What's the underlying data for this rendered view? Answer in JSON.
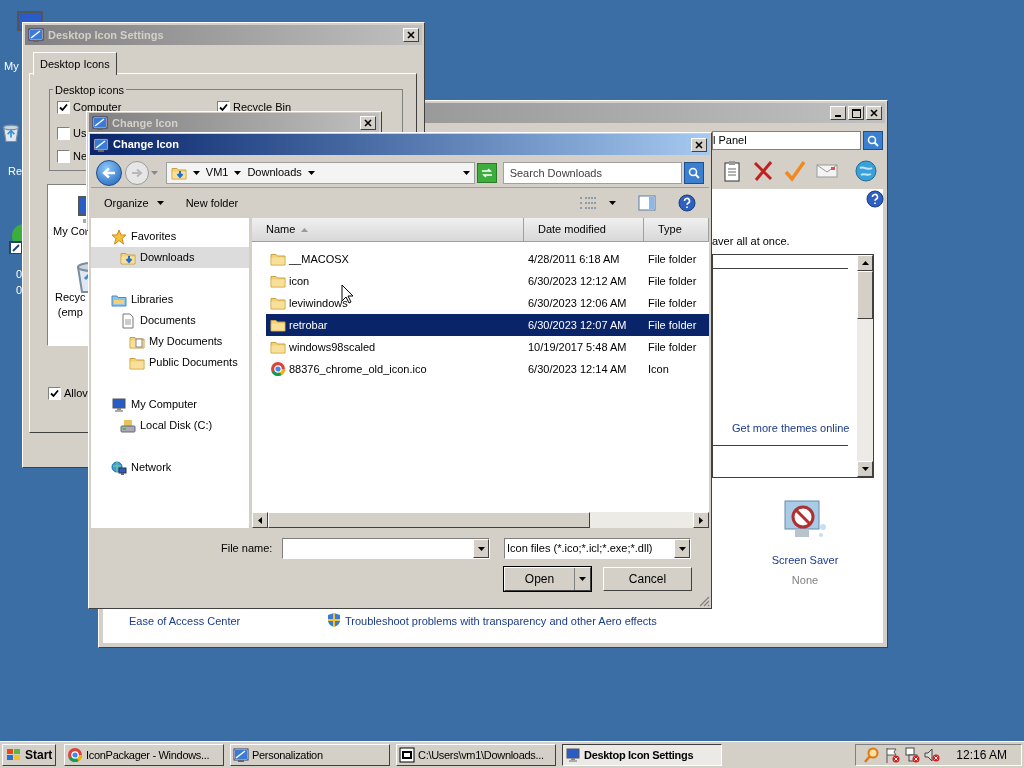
{
  "desktop_icons": [
    {
      "kind": "computer",
      "label_lines": [
        "My"
      ]
    },
    {
      "kind": "recycle",
      "label_lines": [
        "Re"
      ]
    },
    {
      "kind": "app",
      "label_lines": [
        "0",
        "0"
      ]
    }
  ],
  "personalization_window": {
    "active": false,
    "address": "l Panel",
    "intro_fragment": "aver all at once.",
    "themes_link": "Get more themes online",
    "screen_saver": {
      "label": "Screen Saver",
      "value": "None"
    },
    "see_also_link": "Ease of Access Center",
    "troubleshoot_link": "Troubleshoot problems with transparency and other Aero effects"
  },
  "desktop_icon_settings": {
    "title": "Desktop Icon Settings",
    "active": false,
    "tabs": [
      {
        "label": "Desktop Icons",
        "selected": true
      }
    ],
    "group_title": "Desktop icons",
    "checkboxes": [
      {
        "label": "Computer",
        "checked": true
      },
      {
        "label": "Recycle Bin",
        "checked": true
      },
      {
        "label": "Us",
        "checked": false
      },
      {
        "label": "Ne",
        "checked": false
      }
    ],
    "icon_list": [
      {
        "kind": "computer",
        "label_lines": [
          "My Cor"
        ]
      },
      {
        "kind": "recycle",
        "label_lines": [
          "Recyc",
          "(emp"
        ]
      }
    ],
    "allow_checkbox": {
      "label": "Allov",
      "checked": true
    }
  },
  "change_icon_window": {
    "title": "Change Icon",
    "active": false
  },
  "open_dialog": {
    "title": "Change Icon",
    "active": true,
    "address_crumbs": [
      "VM1",
      "Downloads"
    ],
    "search": {
      "placeholder": "Search Downloads"
    },
    "commands": [
      {
        "label": "Organize",
        "dropdown": true
      },
      {
        "label": "New folder",
        "dropdown": false
      }
    ],
    "nav_tree": [
      {
        "kind": "star",
        "label": "Favorites",
        "selected": false,
        "children": [
          {
            "kind": "downloads",
            "label": "Downloads",
            "selected": true
          }
        ]
      },
      {
        "kind": "library",
        "label": "Libraries",
        "selected": false,
        "children": [
          {
            "kind": "document",
            "label": "Documents",
            "selected": false,
            "children": [
              {
                "kind": "docfolder",
                "label": "My Documents",
                "selected": false
              },
              {
                "kind": "folder",
                "label": "Public Documents",
                "selected": false
              }
            ]
          }
        ]
      },
      {
        "kind": "computer",
        "label": "My Computer",
        "selected": false,
        "children": [
          {
            "kind": "disk",
            "label": "Local Disk (C:)",
            "selected": false
          }
        ]
      },
      {
        "kind": "network",
        "label": "Network",
        "selected": false
      }
    ],
    "columns": [
      {
        "label": "Name",
        "sorted": true
      },
      {
        "label": "Date modified",
        "sorted": false
      },
      {
        "label": "Type",
        "sorted": false
      }
    ],
    "files": [
      {
        "kind": "folder",
        "name": "__MACOSX",
        "date": "4/28/2011 6:18 AM",
        "type": "File folder",
        "selected": false
      },
      {
        "kind": "folder",
        "name": "icon",
        "date": "6/30/2023 12:12 AM",
        "type": "File folder",
        "selected": false
      },
      {
        "kind": "folder",
        "name": "leviwindows",
        "date": "6/30/2023 12:06 AM",
        "type": "File folder",
        "selected": false
      },
      {
        "kind": "folder",
        "name": "retrobar",
        "date": "6/30/2023 12:07 AM",
        "type": "File folder",
        "selected": true
      },
      {
        "kind": "folder",
        "name": "windows98scaled",
        "date": "10/19/2017 5:48 AM",
        "type": "File folder",
        "selected": false
      },
      {
        "kind": "chrome",
        "name": "88376_chrome_old_icon.ico",
        "date": "6/30/2023 12:14 AM",
        "type": "Icon",
        "selected": false
      }
    ],
    "file_name_label": "File name:",
    "file_type": "Icon files (*.ico;*.icl;*.exe;*.dll)",
    "buttons": [
      {
        "label": "Open",
        "split": true
      },
      {
        "label": "Cancel",
        "split": false
      }
    ]
  },
  "taskbar": {
    "start": "Start",
    "tasks": [
      {
        "kind": "chrome",
        "label": "IconPackager - Windows...",
        "selected": false
      },
      {
        "kind": "window",
        "label": "Personalization",
        "selected": false
      },
      {
        "kind": "archive",
        "label": "C:\\Users\\vm1\\Downloads...",
        "selected": false
      },
      {
        "kind": "desktop",
        "label": "Desktop Icon Settings",
        "selected": true
      }
    ],
    "clock": "12:16 AM"
  }
}
